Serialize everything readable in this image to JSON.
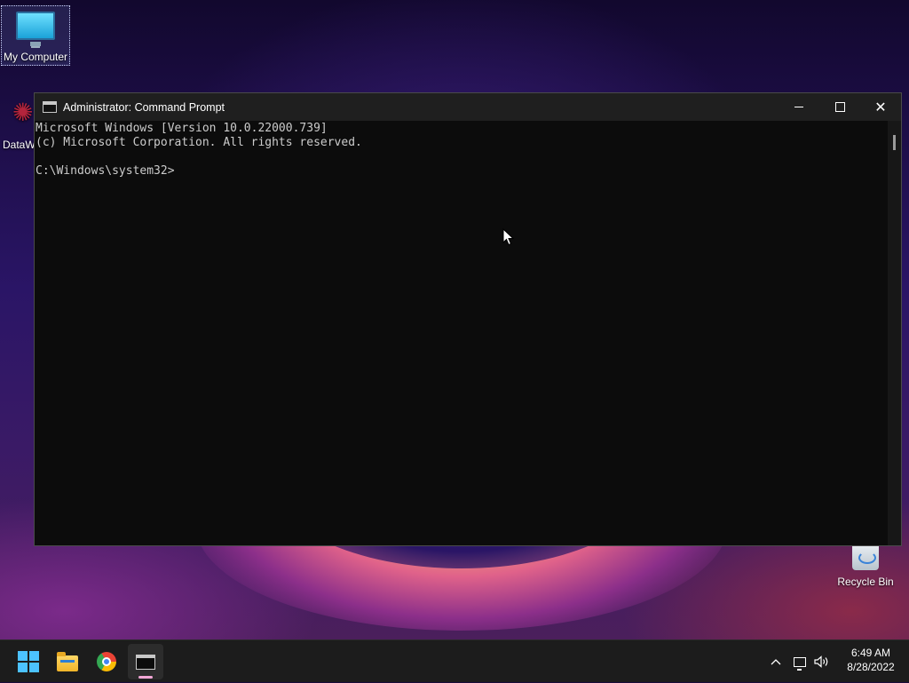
{
  "desktop": {
    "icons": [
      {
        "label": "My Computer"
      },
      {
        "label": "DataW"
      },
      {
        "label": "Recycle Bin"
      }
    ]
  },
  "window": {
    "title": "Administrator: Command Prompt",
    "console_lines": [
      "Microsoft Windows [Version 10.0.22000.739]",
      "(c) Microsoft Corporation. All rights reserved.",
      "",
      "C:\\Windows\\system32>"
    ]
  },
  "taskbar": {
    "apps": [
      {
        "name": "start-icon"
      },
      {
        "name": "file-explorer-icon"
      },
      {
        "name": "chrome-icon"
      },
      {
        "name": "command-prompt-icon",
        "active": true
      }
    ],
    "tray": {
      "time": "6:49 AM",
      "date": "8/28/2022"
    }
  },
  "colors": {
    "console_bg": "#0c0c0c",
    "console_text": "#cccccc",
    "titlebar": "#1f1f1f",
    "taskbar": "#1c1c1c",
    "start_blue": "#4cc2ff"
  }
}
